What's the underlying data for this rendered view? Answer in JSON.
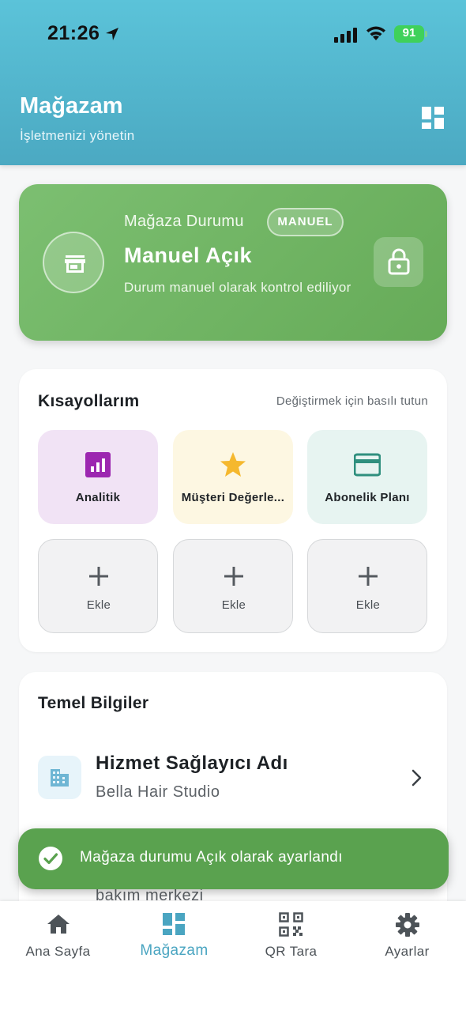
{
  "status_bar": {
    "time": "21:26",
    "battery": "91"
  },
  "header": {
    "title": "Mağazam",
    "subtitle": "İşletmenizi yönetin"
  },
  "store_status": {
    "label": "Mağaza Durumu",
    "badge": "MANUEL",
    "value": "Manuel Açık",
    "description": "Durum manuel olarak kontrol ediliyor"
  },
  "shortcuts": {
    "title": "Kısayollarım",
    "hint": "Değiştirmek için basılı tutun",
    "items": [
      {
        "label": "Analitik",
        "icon": "analytics-icon",
        "bg": "#f1e3f5",
        "color": "#9c27b0"
      },
      {
        "label": "Müşteri Değerlendirmeleri",
        "display": "Müşteri Değerle...",
        "icon": "star-icon",
        "bg": "#fdf7e2",
        "color": "#f5b82e"
      },
      {
        "label": "Abonelik Planı",
        "icon": "credit-card-icon",
        "bg": "#e7f4f1",
        "color": "#2f8f7e"
      }
    ],
    "add_label": "Ekle"
  },
  "basic_info": {
    "title": "Temel Bilgiler",
    "provider_name_label": "Hizmet Sağlayıcı Adı",
    "provider_name_value": "Bella Hair Studio",
    "partial_text": "bakım merkezi"
  },
  "toast": {
    "message": "Mağaza durumu Açık olarak ayarlandı"
  },
  "bottom_nav": [
    {
      "label": "Ana Sayfa",
      "icon": "home-icon"
    },
    {
      "label": "Mağazam",
      "icon": "dashboard-icon",
      "active": true
    },
    {
      "label": "QR Tara",
      "icon": "qr-code-icon"
    },
    {
      "label": "Ayarlar",
      "icon": "settings-icon"
    }
  ],
  "colors": {
    "accent": "#4aa5c1",
    "status_green": "#6db361",
    "toast_green": "#5aa24f"
  }
}
